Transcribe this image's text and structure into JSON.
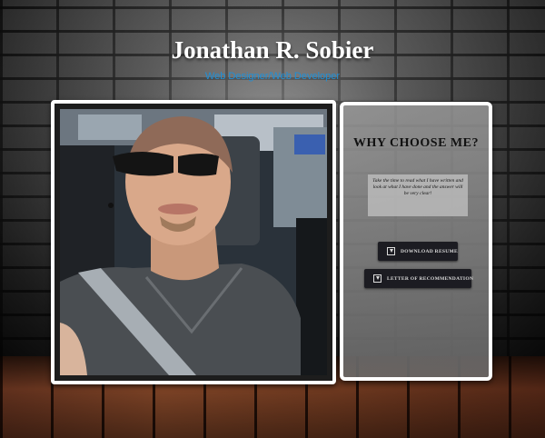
{
  "header": {
    "name": "Jonathan R. Sobier",
    "tagline": "Web Designer/Web Developer"
  },
  "photo": {
    "alt": "Jonathan R. Sobier"
  },
  "panel": {
    "heading": "WHY CHOOSE ME?",
    "blurb": "Take the time to read what I have written and look at what I have done and the answer will be very clear!",
    "buttons": [
      {
        "label": "DOWNLOAD RESUME",
        "icon": "download-icon"
      },
      {
        "label": "LETTER OF RECOMMENDATION",
        "icon": "download-icon"
      }
    ]
  },
  "colors": {
    "tagline": "#1e90d8",
    "button_bg": "#1c1c22",
    "frame": "#ffffff"
  }
}
